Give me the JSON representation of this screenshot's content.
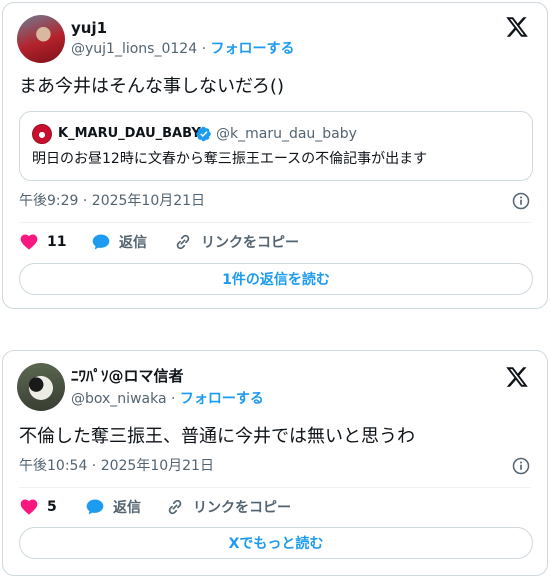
{
  "tweet1": {
    "display_name": "yuj1",
    "handle": "@yuj1_lions_0124",
    "separator": "·",
    "follow_label": "フォローする",
    "text": "まあ今井はそんな事しないだろ()",
    "quote": {
      "display_name": "K_MARU_DAU_BABY",
      "handle": "@k_maru_dau_baby",
      "text": "明日のお昼12時に文春から奪三振王エースの不倫記事が出ます"
    },
    "timestamp": "午後9:29 · 2025年10月21日",
    "like_count": "11",
    "reply_label": "返信",
    "copy_link_label": "リンクをコピー",
    "read_replies_label": "1件の返信を読む"
  },
  "tweet2": {
    "display_name": "ﾆﾜﾊﾟｿ@ロマ信者",
    "handle": "@box_niwaka",
    "separator": "·",
    "follow_label": "フォローする",
    "text": "不倫した奪三振王、普通に今井では無いと思うわ",
    "timestamp": "午後10:54 · 2025年10月21日",
    "like_count": "5",
    "reply_label": "返信",
    "copy_link_label": "リンクをコピー",
    "read_more_label": "Xでもっと読む"
  },
  "icons": {
    "logo": "x-logo-icon",
    "like": "heart-icon",
    "reply": "speech-bubble-icon",
    "copy": "link-icon",
    "info": "info-icon",
    "verified": "verified-badge-icon"
  },
  "colors": {
    "accent": "#1d9bf0",
    "like": "#f91880",
    "text_primary": "#0f1419",
    "text_secondary": "#536471",
    "border": "#cfd9de"
  }
}
